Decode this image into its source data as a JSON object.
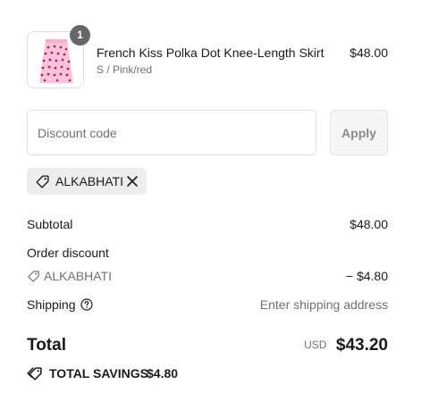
{
  "product": {
    "name": "French Kiss Polka Dot Knee-Length Skirt",
    "variant": "S / Pink/red",
    "price": "$48.00",
    "quantity": "1",
    "image_icon": "skirt-thumbnail"
  },
  "discount_form": {
    "placeholder": "Discount code",
    "value": "",
    "apply_label": "Apply"
  },
  "applied_code": {
    "code": "ALKABHATI",
    "icon": "tag-icon",
    "remove_icon": "close-icon"
  },
  "summary": {
    "subtotal_label": "Subtotal",
    "subtotal_value": "$48.00",
    "order_discount_label": "Order discount",
    "discount_code": "ALKABHATI",
    "discount_value": "− $4.80",
    "shipping_label": "Shipping",
    "shipping_value": "Enter shipping address",
    "total_label": "Total",
    "currency": "USD",
    "total_value": "$43.20",
    "savings_label": "TOTAL SAVINGS",
    "savings_value": "$4.80"
  },
  "colors": {
    "text": "#1a1a1a",
    "muted": "#707070",
    "chip_bg": "#ededed",
    "badge_bg": "#666666",
    "skirt_pink": "#f6c5d9",
    "dot_red": "#c2185b"
  }
}
